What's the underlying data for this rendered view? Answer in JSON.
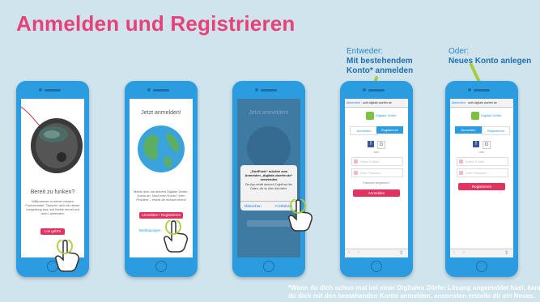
{
  "title": "Anmelden und Registrieren",
  "callout_left": {
    "line1": "Entweder:",
    "line2": "Mit bestehendem",
    "line3": "Konto* anmelden"
  },
  "callout_right": {
    "line1": "Oder:",
    "line2": "Neues Konto anlegen"
  },
  "phone1": {
    "heading": "Bereit zu funken?",
    "body": "Willkommen in deiner lokalen Funkzentrale. Tausche dich mit deiner Umgebung aus und bleibe immer auf dem Laufenden!",
    "button": "Los geht's"
  },
  "phone2": {
    "heading": "Jetzt anmelden!",
    "body": "Melde dich mit deinem Digitale Dörfer-Konto an. Noch kein Konto? Kein Problem – erstell dir einfach eines!",
    "button": "Anmelden / Registrieren",
    "link": "Bedingungen"
  },
  "phone3": {
    "heading": "Jetzt anmelden!",
    "dialog_title": "„DorfFunk“ möchte zum Anmelden „digitale-doerfer.de“ verwenden",
    "dialog_body": "Die App erhält dadurch Zugriff auf die Daten, die du über dich teilst.",
    "cancel": "Abbrechen",
    "continue": "Fortfahren"
  },
  "phone4": {
    "url": "auth.digitale-doerfer.de",
    "cancel": "Abbrechen",
    "brand": "Digitale Dörfer",
    "tab_login": "Anmelden",
    "tab_register": "Registrieren",
    "or": "oder",
    "email_placeholder": "Deine E-Mail",
    "password_placeholder": "Dein Passwort",
    "forgot": "Passwort vergessen?",
    "submit": "Anmelden"
  },
  "phone5": {
    "url": "auth.digitale-doerfer.de",
    "cancel": "Abbrechen",
    "brand": "Digitale Dörfer",
    "tab_login": "Anmelden",
    "tab_register": "Registrieren",
    "or": "oder",
    "email_placeholder": "Deine E-Mail",
    "password_placeholder": "Dein Passwort",
    "submit": "Registrieren"
  },
  "footnote": {
    "line1": "*Wenn du dich schon mal bei einer Digitalen Dörfer Lösung angemeldet hast, kannst",
    "line2": "du dich mit den bestehenden Konto anmelden, ansonsten erstelle dir ein Neues."
  },
  "colors": {
    "title": "#e8417a",
    "phone": "#2c9ce0",
    "accent_pink": "#e0335f",
    "callout": "#2b86c9",
    "arrow": "#a6ce39",
    "background": "#cfe4ec"
  }
}
